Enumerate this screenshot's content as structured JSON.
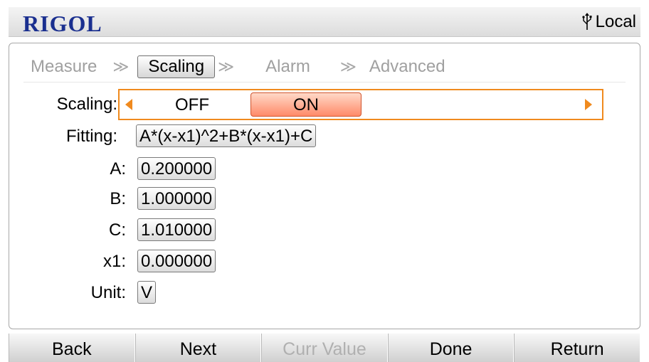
{
  "header": {
    "logo": "RIGOL",
    "status_label": "Local",
    "status_icon": "usb-icon"
  },
  "breadcrumb": {
    "items": [
      "Measure",
      "Scaling",
      "Alarm",
      "Advanced"
    ],
    "active": "Scaling",
    "separator": "≫"
  },
  "form": {
    "scaling": {
      "label": "Scaling:",
      "options": [
        "OFF",
        "ON"
      ],
      "selected": "ON"
    },
    "fitting": {
      "label": "Fitting:",
      "value": "A*(x-x1)^2+B*(x-x1)+C"
    },
    "a": {
      "label": "A:",
      "value": "0.200000"
    },
    "b": {
      "label": "B:",
      "value": "1.000000"
    },
    "c": {
      "label": "C:",
      "value": "1.010000"
    },
    "x1": {
      "label": "x1:",
      "value": "0.000000"
    },
    "unit": {
      "label": "Unit:",
      "value": "V"
    }
  },
  "softkeys": [
    {
      "label": "Back",
      "enabled": true
    },
    {
      "label": "Next",
      "enabled": true
    },
    {
      "label": "Curr Value",
      "enabled": false
    },
    {
      "label": "Done",
      "enabled": true
    },
    {
      "label": "Return",
      "enabled": true
    }
  ],
  "colors": {
    "brand": "#1a2f8f",
    "focus": "#f08a1e",
    "selected": "#ff8a68"
  }
}
